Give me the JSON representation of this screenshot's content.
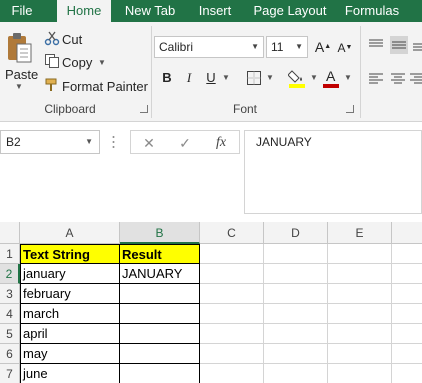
{
  "tabs": [
    {
      "label": "File",
      "active": false
    },
    {
      "label": "Home",
      "active": true
    },
    {
      "label": "New Tab",
      "active": false
    },
    {
      "label": "Insert",
      "active": false
    },
    {
      "label": "Page Layout",
      "active": false
    },
    {
      "label": "Formulas",
      "active": false
    }
  ],
  "clipboard": {
    "paste_label": "Paste",
    "cut_label": "Cut",
    "copy_label": "Copy",
    "format_painter_label": "Format Painter",
    "group_label": "Clipboard"
  },
  "font": {
    "font_name": "Calibri",
    "font_size": "11",
    "bold": "B",
    "italic": "I",
    "underline": "U",
    "group_label": "Font",
    "grow_label": "A",
    "shrink_label": "A",
    "highlight_color": "#ffff00",
    "font_color": "#c00000"
  },
  "formula_bar": {
    "name_box": "B2",
    "cancel_symbol": "✕",
    "enter_symbol": "✓",
    "fx_symbol": "fx",
    "content": "JANUARY"
  },
  "grid": {
    "columns": [
      "A",
      "B",
      "C",
      "D",
      "E"
    ],
    "rows": [
      "1",
      "2",
      "3",
      "4",
      "5",
      "6",
      "7"
    ],
    "cells": [
      [
        "Text String",
        "Result"
      ],
      [
        "january",
        "JANUARY"
      ],
      [
        "february",
        ""
      ],
      [
        "march",
        ""
      ],
      [
        "april",
        ""
      ],
      [
        "may",
        ""
      ],
      [
        "june",
        ""
      ]
    ]
  },
  "colors": {
    "accent": "#217346",
    "header_fill": "#ffff00"
  }
}
